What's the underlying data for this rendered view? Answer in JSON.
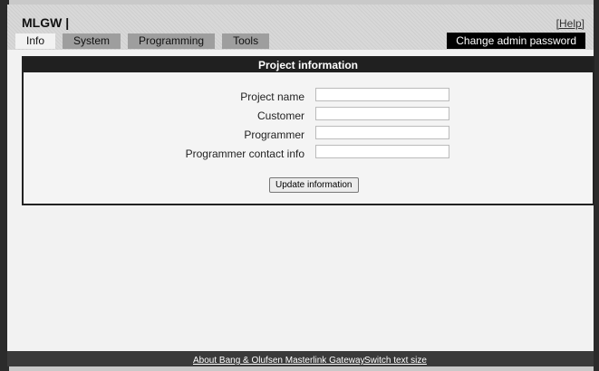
{
  "header": {
    "logo": "MLGW |",
    "help_label": "[Help]",
    "tabs": [
      {
        "label": "Info",
        "active": true
      },
      {
        "label": "System",
        "active": false
      },
      {
        "label": "Programming",
        "active": false
      },
      {
        "label": "Tools",
        "active": false
      }
    ],
    "admin_button": "Change admin password"
  },
  "panel": {
    "title": "Project information",
    "fields": [
      {
        "label": "Project name",
        "value": ""
      },
      {
        "label": "Customer",
        "value": ""
      },
      {
        "label": "Programmer",
        "value": ""
      },
      {
        "label": "Programmer contact info",
        "value": ""
      }
    ],
    "update_button": "Update information"
  },
  "footer": {
    "about_link": "About Bang & Olufsen Masterlink Gateway",
    "text_size_link": "Switch text size"
  }
}
